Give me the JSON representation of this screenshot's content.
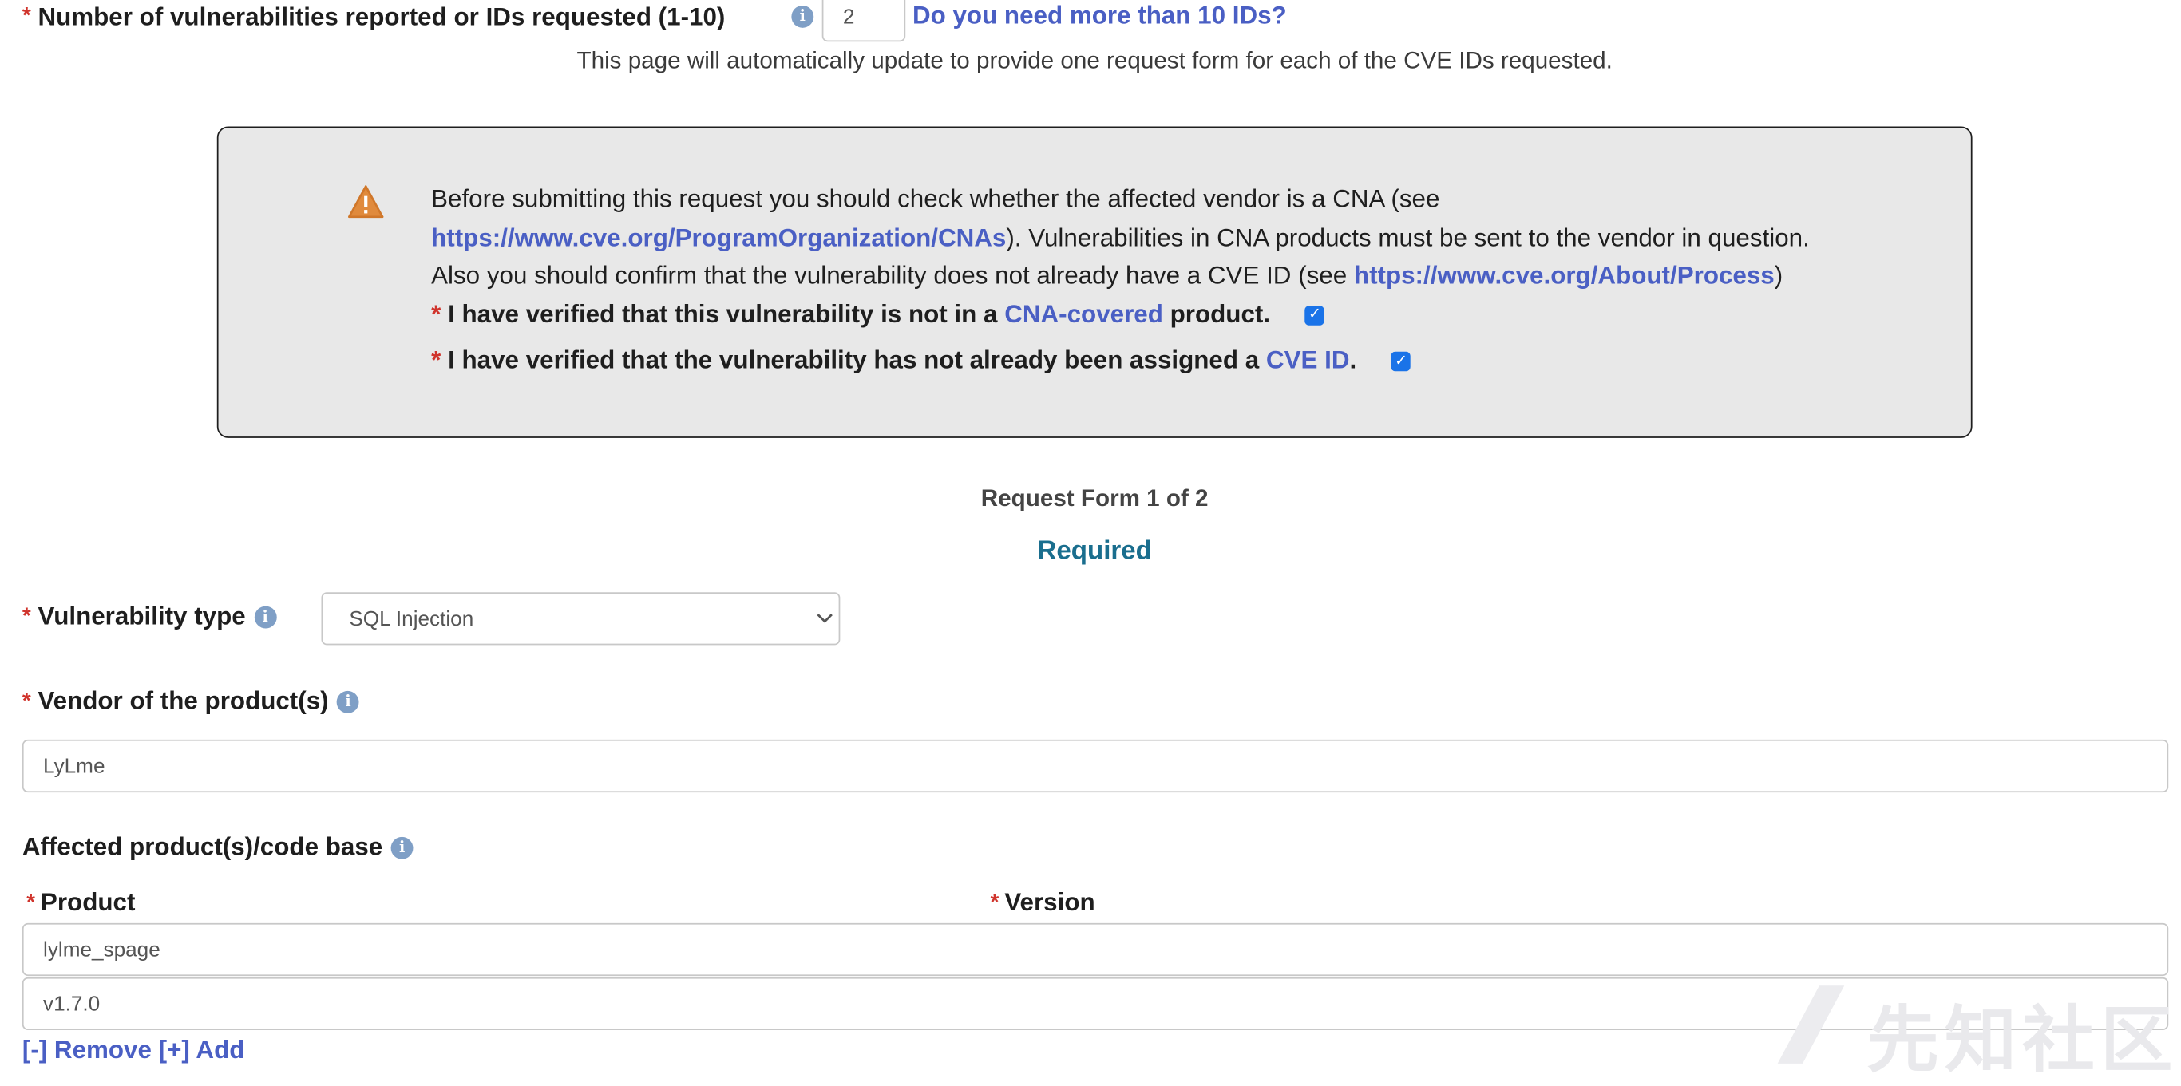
{
  "count": {
    "label": "Number of vulnerabilities reported or IDs requested (1-10)",
    "value": "2",
    "more_link": "Do you need more than 10 IDs?",
    "note": "This page will automatically update to provide one request form for each of the CVE IDs requested."
  },
  "notice": {
    "line1": "Before submitting this request you should check whether the affected vendor is a CNA (see",
    "cna_link": "https://www.cve.org/ProgramOrganization/CNAs",
    "line2_rest": "). Vulnerabilities in CNA products must be sent to the vendor in question.",
    "line3": "Also you should confirm that the vulnerability does not already have a CVE ID (see",
    "process_link": "https://www.cve.org/About/Process",
    "line3_end": ")",
    "check1_prefix": "I have verified that this vulnerability is not in a",
    "check1_link": "CNA-covered",
    "check1_suffix": "product.",
    "check1_checked": true,
    "check2_prefix": "I have verified that the vulnerability has not already been assigned a",
    "check2_link": "CVE ID",
    "check2_suffix": ".",
    "check2_checked": true
  },
  "form": {
    "heading": "Request Form 1 of 2",
    "required_label": "Required",
    "vuln_type_label": "Vulnerability type",
    "vuln_type_value": "SQL Injection",
    "vendor_label": "Vendor of the product(s)",
    "vendor_value": "LyLme",
    "affected_label": "Affected product(s)/code base",
    "product_col": "Product",
    "version_col": "Version",
    "product_value": "lylme_spage",
    "version_value": "v1.7.0",
    "remove_label": "[-] Remove",
    "add_label": "[+] Add"
  },
  "watermark": "先知社区",
  "colors": {
    "link": "#4a5fc4",
    "required_star": "#d0342c",
    "required_heading": "#1a6e8e",
    "notice_bg": "#e8e8e8"
  }
}
